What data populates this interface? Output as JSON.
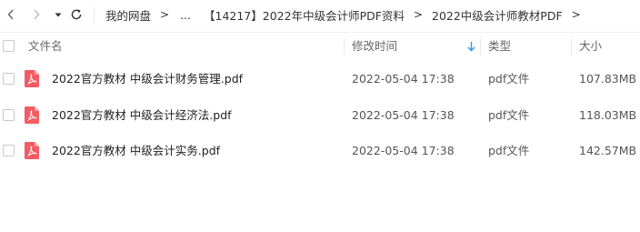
{
  "toolbar": {
    "back_icon": "chevron-left-icon",
    "forward_icon": "chevron-right-icon",
    "history_icon": "caret-down-icon",
    "refresh_icon": "refresh-icon"
  },
  "breadcrumb": {
    "root": "我的网盘",
    "sep": ">",
    "ellipsis": "...",
    "folder1": "【14217】2022年中级会计师PDF资料",
    "folder2": "2022中级会计师教材PDF",
    "trailing": ">"
  },
  "columns": {
    "name": "文件名",
    "modified": "修改时间",
    "type": "类型",
    "size": "大小"
  },
  "files": [
    {
      "name": "2022官方教材 中级会计财务管理.pdf",
      "modified": "2022-05-04 17:38",
      "type": "pdf文件",
      "size": "107.83MB"
    },
    {
      "name": "2022官方教材 中级会计经济法.pdf",
      "modified": "2022-05-04 17:38",
      "type": "pdf文件",
      "size": "118.03MB"
    },
    {
      "name": "2022官方教材 中级会计实务.pdf",
      "modified": "2022-05-04 17:38",
      "type": "pdf文件",
      "size": "142.57MB"
    }
  ],
  "colors": {
    "pdf_icon": "#f25c64",
    "sort_accent": "#1a9cf0"
  }
}
